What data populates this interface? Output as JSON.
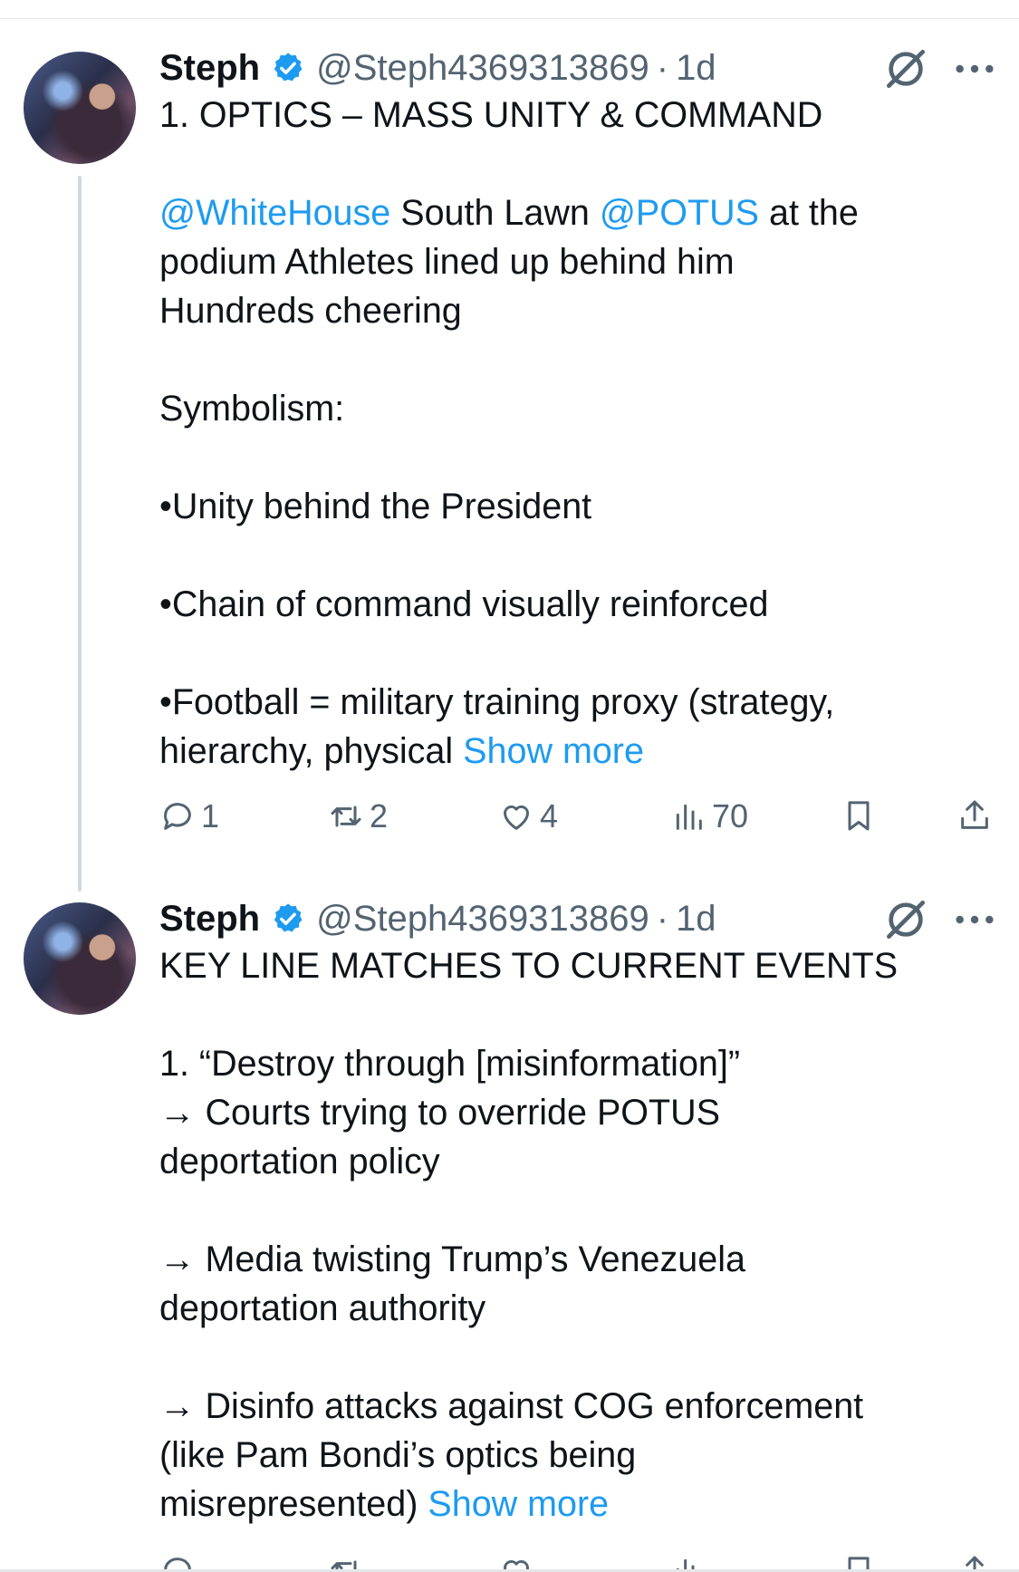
{
  "tweets": [
    {
      "name": "Steph",
      "handle": "@Steph4369313869",
      "separator": "·",
      "time": "1d",
      "body": {
        "l1": "1. OPTICS – MASS UNITY & COMMAND",
        "l2_mention1": "@WhiteHouse",
        "l2_text1": " South Lawn ",
        "l2_mention2": "@POTUS",
        "l2_text2": " at the",
        "l3": "podium Athletes lined up behind him",
        "l4": "Hundreds cheering",
        "l5": "Symbolism:",
        "l6": "•Unity behind the President",
        "l7": "•Chain of command visually reinforced",
        "l8": "•Football = military training proxy (strategy,",
        "l9": "hierarchy, physical ",
        "show_more": "Show more"
      },
      "stats": {
        "replies": "1",
        "reposts": "2",
        "likes": "4",
        "views": "70"
      }
    },
    {
      "name": "Steph",
      "handle": "@Steph4369313869",
      "separator": "·",
      "time": "1d",
      "body": {
        "l1": "KEY LINE MATCHES TO CURRENT EVENTS",
        "l2": "1. “Destroy through [misinformation]”",
        "l3": "→ Courts trying to override POTUS",
        "l4": "deportation policy",
        "l5": "→ Media twisting Trump’s Venezuela",
        "l6": "deportation authority",
        "l7": "→ Disinfo attacks against COG enforcement",
        "l8": "(like Pam Bondi’s optics being",
        "l9": "misrepresented) ",
        "show_more": "Show more"
      }
    }
  ],
  "icons": {
    "verified": "verified-badge-icon",
    "grok": "grok-icon",
    "more": "more-icon",
    "reply": "reply-icon",
    "repost": "repost-icon",
    "like": "like-icon",
    "views": "views-icon",
    "bookmark": "bookmark-icon",
    "share": "share-icon"
  },
  "colors": {
    "link": "#1d9bf0",
    "verified": "#1d9bf0",
    "muted": "#536471",
    "text": "#0f1419"
  }
}
